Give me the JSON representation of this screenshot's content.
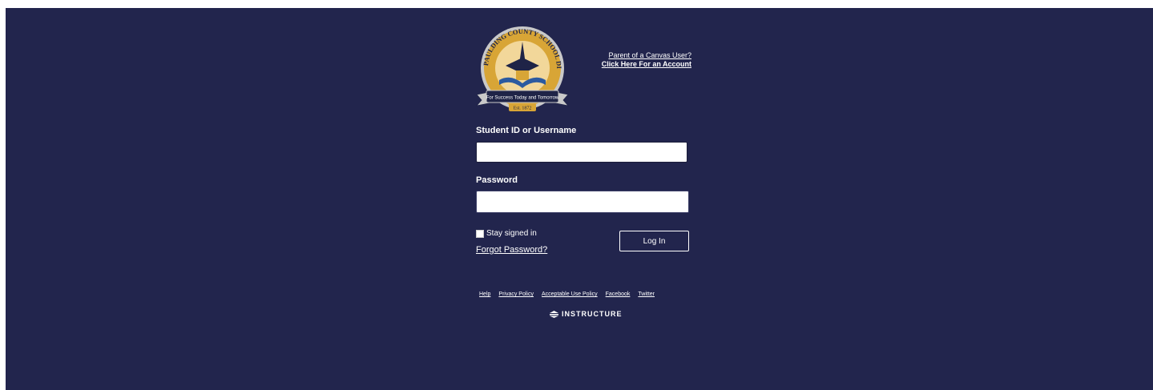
{
  "logo": {
    "name": "Paulding County School District seal",
    "ring_text": "PAULDING COUNTY SCHOOL DISTRICT",
    "banner_text": "For Success Today and Tomorrow",
    "est_text": "Est. 1872",
    "colors": {
      "gold": "#d8a536",
      "navy": "#1f2447",
      "silver": "#c9c9c9"
    }
  },
  "parent_link": {
    "line1": "Parent of a Canvas User?",
    "line2": "Click Here For an Account"
  },
  "form": {
    "username_label": "Student ID or Username",
    "username_value": "",
    "password_label": "Password",
    "password_value": "",
    "stay_signed_in": "Stay signed in",
    "forgot_password": "Forgot Password?",
    "login_button": "Log In"
  },
  "footer": {
    "links": [
      "Help",
      "Privacy Policy",
      "Acceptable Use Policy",
      "Facebook",
      "Twitter"
    ],
    "brand": "INSTRUCTURE"
  },
  "colors": {
    "background": "#22254d",
    "text": "#ffffff"
  }
}
